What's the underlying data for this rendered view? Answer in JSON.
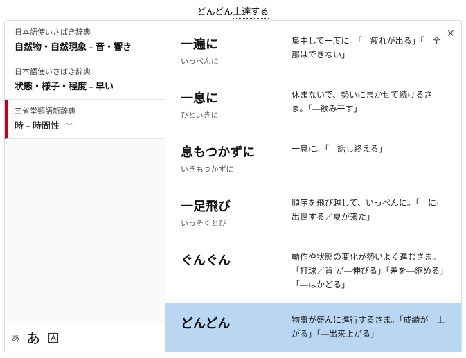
{
  "header": {
    "part1": "どんどん",
    "part2": "上達する"
  },
  "close_label": "×",
  "sidebar": {
    "items": [
      {
        "source": "日本語使いさばき辞典",
        "title": "自然物・自然現象 – 音・響き"
      },
      {
        "source": "日本語使いさばき辞典",
        "title": "状態・様子・程度 – 早い"
      },
      {
        "source": "三省堂類語新辞典",
        "title": "時 – 時間性"
      }
    ],
    "footer": {
      "small": "あ",
      "large": "あ"
    }
  },
  "entries": [
    {
      "word": "一遍に",
      "reading": "いっぺんに",
      "def": "集中して一度に。「―疲れが出る」「―全部はできない」"
    },
    {
      "word": "一息に",
      "reading": "ひといきに",
      "def": "休まないで、勢いにまかせて続けるさま。「―飲み干す」"
    },
    {
      "word": "息もつかずに",
      "reading": "いきもつかずに",
      "def": "一息に。「―話し終える」"
    },
    {
      "word": "一足飛び",
      "reading": "いっそくとび",
      "def": "順序を飛び越して、いっぺんに。「―に·出世する／夏が来た」"
    },
    {
      "word": "ぐんぐん",
      "reading": "",
      "def": "動作や状態の変化が勢いよく進むさま。「打球／背·が―伸びる」「差を―縮める」「―はかどる」"
    },
    {
      "word": "どんどん",
      "reading": "",
      "def": "物事が盛んに進行するさま。「成績が―上がる」「―出来上がる」"
    }
  ]
}
